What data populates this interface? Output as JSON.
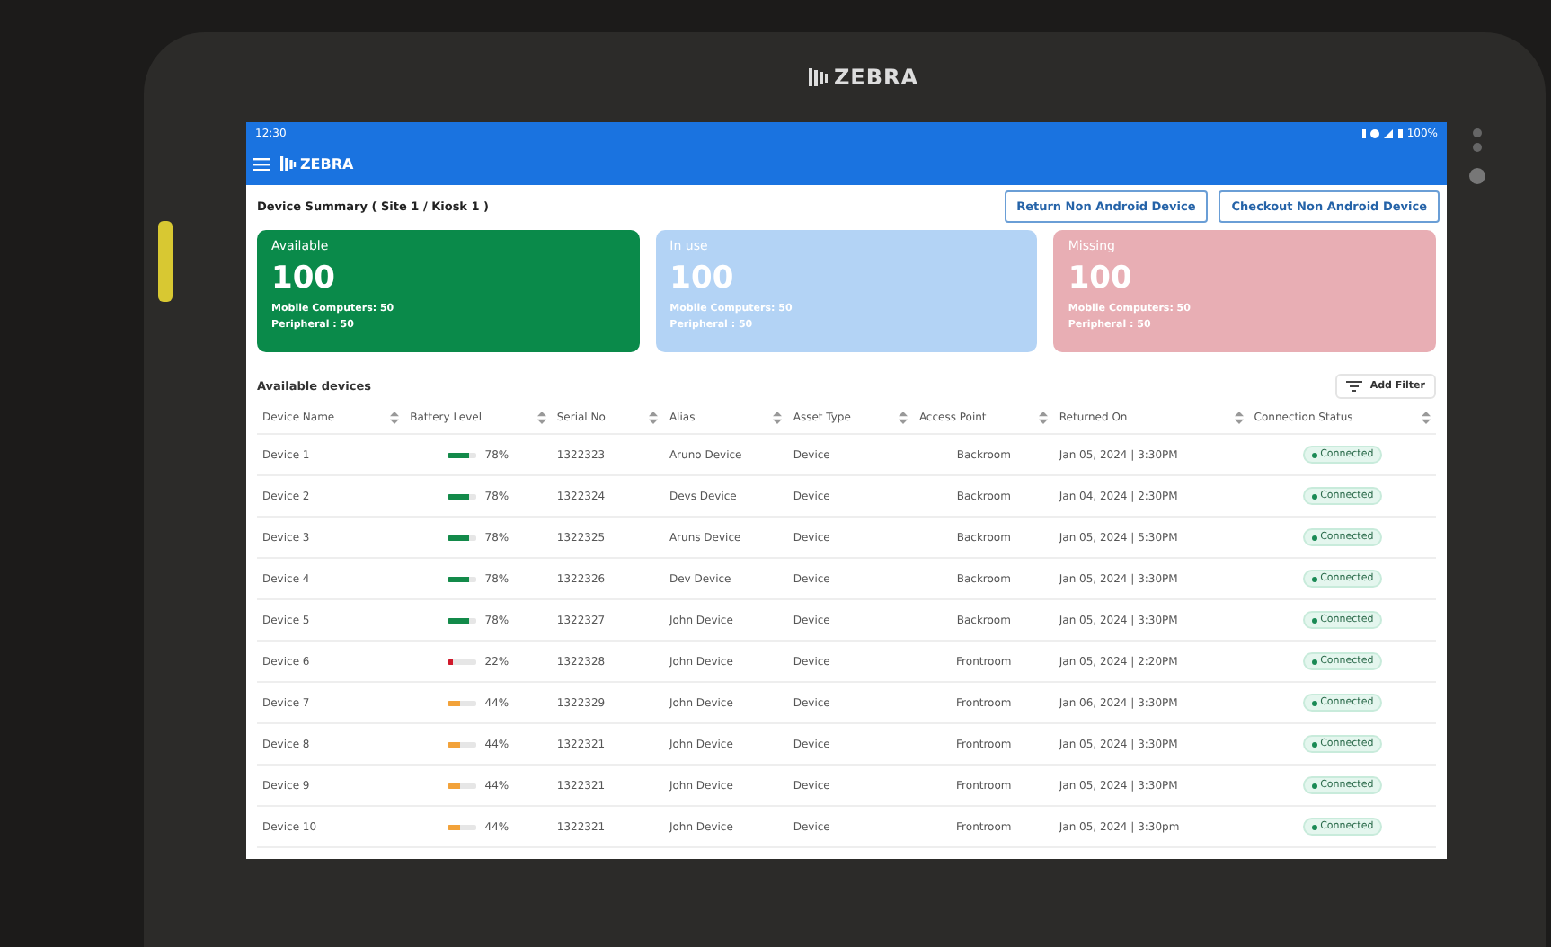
{
  "device": {
    "brand": "ZEBRA"
  },
  "status_bar": {
    "time": "12:30",
    "battery": "100%"
  },
  "app_bar": {
    "logo": "ZEBRA"
  },
  "header": {
    "title": "Device Summary ( Site 1 / Kiosk 1 )",
    "buttons": [
      "Return Non Android Device",
      "Checkout Non Android Device"
    ]
  },
  "summary_cards": [
    {
      "label": "Available",
      "count": "100",
      "lines": [
        "Mobile Computers: 50",
        "Peripheral : 50"
      ],
      "color": "#0a8a4a"
    },
    {
      "label": "In use",
      "count": "100",
      "lines": [
        "Mobile Computers: 50",
        "Peripheral : 50"
      ],
      "color": "#b3d3f5"
    },
    {
      "label": "Missing",
      "count": "100",
      "lines": [
        "Mobile Computers: 50",
        "Peripheral : 50"
      ],
      "color": "#e8aeb4"
    }
  ],
  "section": {
    "title": "Available devices",
    "filter_button": "Add Filter"
  },
  "table": {
    "columns": [
      "Device Name",
      "Battery Level",
      "Serial No",
      "Alias",
      "Asset Type",
      "Access Point",
      "Returned On",
      "Connection Status"
    ],
    "rows": [
      {
        "name": "Device 1",
        "level": 0.78,
        "reading": "78%",
        "color": "#138a4a",
        "serial": "1322323",
        "alias": "Aruno Device",
        "asset_type": "Device",
        "access_point": "Backroom",
        "returned_on": "Jan 05, 2024 | 3:30PM",
        "status": "Connected"
      },
      {
        "name": "Device 2",
        "level": 0.78,
        "reading": "78%",
        "color": "#138a4a",
        "serial": "1322324",
        "alias": "Devs Device",
        "asset_type": "Device",
        "access_point": "Backroom",
        "returned_on": "Jan 04, 2024 | 2:30PM",
        "status": "Connected"
      },
      {
        "name": "Device 3",
        "level": 0.78,
        "reading": "78%",
        "color": "#138a4a",
        "serial": "1322325",
        "alias": "Aruns Device",
        "asset_type": "Device",
        "access_point": "Backroom",
        "returned_on": "Jan 05, 2024 | 5:30PM",
        "status": "Connected"
      },
      {
        "name": "Device 4",
        "level": 0.78,
        "reading": "78%",
        "color": "#138a4a",
        "serial": "1322326",
        "alias": "Dev Device",
        "asset_type": "Device",
        "access_point": "Backroom",
        "returned_on": "Jan 05, 2024 | 3:30PM",
        "status": "Connected"
      },
      {
        "name": "Device 5",
        "level": 0.78,
        "reading": "78%",
        "color": "#138a4a",
        "serial": "1322327",
        "alias": "John Device",
        "asset_type": "Device",
        "access_point": "Backroom",
        "returned_on": "Jan 05, 2024 | 3:30PM",
        "status": "Connected"
      },
      {
        "name": "Device 6",
        "level": 0.22,
        "reading": "22%",
        "color": "#d0192b",
        "serial": "1322328",
        "alias": "John Device",
        "asset_type": "Device",
        "access_point": "Frontroom",
        "returned_on": "Jan 05, 2024 | 2:20PM",
        "status": "Connected"
      },
      {
        "name": "Device 7",
        "level": 0.44,
        "reading": "44%",
        "color": "#f2a23a",
        "serial": "1322329",
        "alias": "John Device",
        "asset_type": "Device",
        "access_point": "Frontroom",
        "returned_on": "Jan 06, 2024 | 3:30PM",
        "status": "Connected"
      },
      {
        "name": "Device 8",
        "level": 0.44,
        "reading": "44%",
        "color": "#f2a23a",
        "serial": "1322321",
        "alias": "John Device",
        "asset_type": "Device",
        "access_point": "Frontroom",
        "returned_on": "Jan 05, 2024 | 3:30PM",
        "status": "Connected"
      },
      {
        "name": "Device 9",
        "level": 0.44,
        "reading": "44%",
        "color": "#f2a23a",
        "serial": "1322321",
        "alias": "John Device",
        "asset_type": "Device",
        "access_point": "Frontroom",
        "returned_on": "Jan 05, 2024 | 3:30PM",
        "status": "Connected"
      },
      {
        "name": "Device 10",
        "level": 0.44,
        "reading": "44%",
        "color": "#f2a23a",
        "serial": "1322321",
        "alias": "John Device",
        "asset_type": "Device",
        "access_point": "Frontroom",
        "returned_on": "Jan 05, 2024 | 3:30pm",
        "status": "Connected"
      }
    ]
  }
}
